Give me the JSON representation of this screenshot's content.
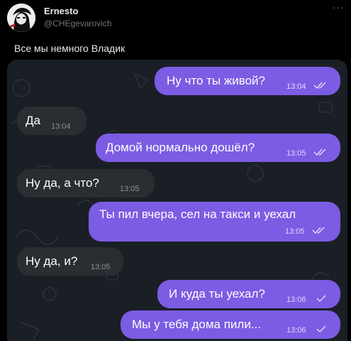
{
  "tweet": {
    "author_name": "Ernesto",
    "author_handle": "@CHEgevarovich",
    "more_icon": "more-horizontal-icon",
    "text": "Все мы немного Владик"
  },
  "chat": {
    "colors": {
      "incoming": "#2a2e33",
      "outgoing": "#7b5ce3",
      "background": "#1a1f25"
    },
    "messages": [
      {
        "direction": "outgoing",
        "text": "Ну что ты живой?",
        "time": "13:04",
        "status": "double-check"
      },
      {
        "direction": "incoming",
        "text": "Да",
        "time": "13:04"
      },
      {
        "direction": "outgoing",
        "text": "Домой нормально дошёл?",
        "time": "13:05",
        "status": "double-check"
      },
      {
        "direction": "incoming",
        "text": "Ну да, а что?",
        "time": "13:05"
      },
      {
        "direction": "outgoing",
        "text": "Ты пил вчера, сел на такси и уехал",
        "time": "13:05",
        "status": "double-check"
      },
      {
        "direction": "incoming",
        "text": "Ну да, и?",
        "time": "13:05"
      },
      {
        "direction": "outgoing",
        "text": "И куда ты уехал?",
        "time": "13:06",
        "status": "single-check"
      },
      {
        "direction": "outgoing",
        "text": "Мы у тебя дома пили...",
        "time": "13:06",
        "status": "single-check"
      }
    ]
  }
}
